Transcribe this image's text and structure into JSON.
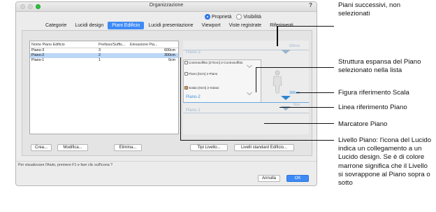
{
  "window": {
    "title": "Organizzazione",
    "help": "?"
  },
  "radios": [
    {
      "label": "Proprietà",
      "selected": true
    },
    {
      "label": "Visibilità",
      "selected": false
    }
  ],
  "tabs": [
    {
      "label": "Categorie",
      "active": false
    },
    {
      "label": "Lucidi design",
      "active": false
    },
    {
      "label": "Piani Edificio",
      "active": true
    },
    {
      "label": "Lucidi presentazione",
      "active": false
    },
    {
      "label": "Viewport",
      "active": false
    },
    {
      "label": "Viste registrate",
      "active": false
    },
    {
      "label": "Riferimenti",
      "active": false
    }
  ],
  "table": {
    "headers": [
      "Nome Piano Edificio",
      "Prefisso/Suffis...",
      "Elevazione Pia..."
    ],
    "rows": [
      {
        "name": "Piano-3",
        "prefix": "3",
        "elevation": "600cm",
        "selected": false
      },
      {
        "name": "Piano-2",
        "prefix": "2",
        "elevation": "300cm",
        "selected": true
      },
      {
        "name": "Piano-1",
        "prefix": "1",
        "elevation": "0cm",
        "selected": false
      }
    ]
  },
  "buttons": {
    "crea": "Crea...",
    "modifica": "Modifica...",
    "elimina": "Elimina...",
    "tipi_livello": "Tipi Livello...",
    "livelli_standard": "Livelli standard Edificio...",
    "annulla": "Annulla",
    "ok": "OK"
  },
  "preview": {
    "levels": [
      {
        "name": "Piano-3",
        "elevation": "600cm",
        "selected": false
      },
      {
        "name": "Piano-2",
        "elevation": "300cm",
        "selected": true
      },
      {
        "name": "Piano-1",
        "elevation": "0cm",
        "selected": false
      }
    ],
    "layers": [
      {
        "label": "Controsoffitto [270cm] 2-Controsoffitto",
        "brown": false
      },
      {
        "label": "Piano [0cm] 2-Piano",
        "brown": false
      },
      {
        "label": "Solaio [0cm] 2-Solaio",
        "brown": true
      }
    ]
  },
  "status_text": "Per visualizzare l'Aiuto, premere F1 e fare clic sull'icona ?",
  "callouts": {
    "piani_successivi": "Piani successivi, non selezionati",
    "struttura": "Struttura espansa del Piano selezionato nella lista",
    "figura": "Figura riferimento Scala",
    "linea": "Linea riferimento Piano",
    "marcatore": "Marcatore Piano",
    "livello": "Livello Piano: l'icona del Lucido indica un collegamento a un Lucido design. Se è di colore marrone significa che il Livello si sovrappone al Piano sopra o sotto"
  },
  "colors": {
    "accent": "#3d8af7",
    "selected_row": "#bcd6f5",
    "marker_selected": "#2d86cf",
    "marker": "#9ab5cb",
    "layer_brown": "#c8a070"
  }
}
